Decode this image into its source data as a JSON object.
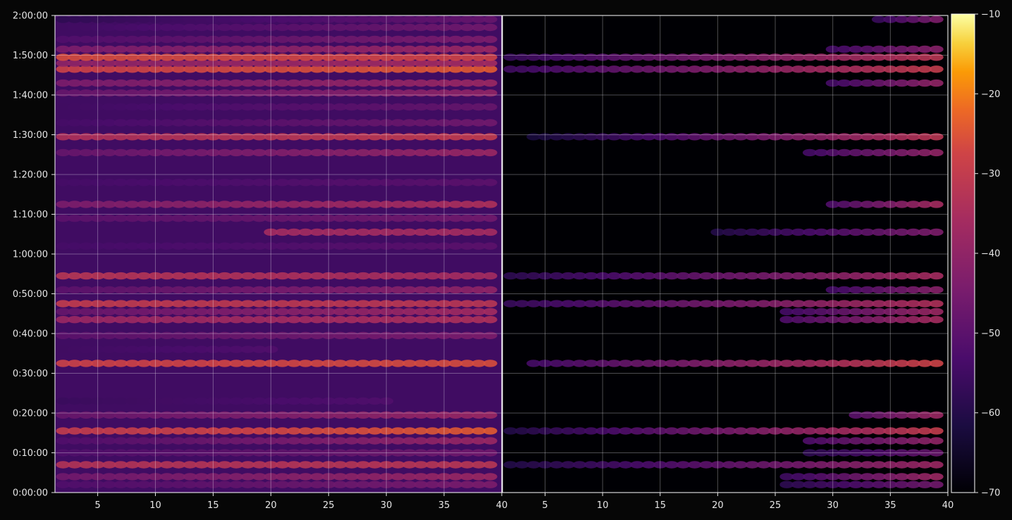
{
  "chart_data": {
    "type": "heatmap",
    "title": "",
    "colormap": "inferno",
    "background": "#060606",
    "grid": true,
    "panels": [
      {
        "name": "",
        "xlim": [
          1.3,
          40
        ],
        "xticks": [
          "5",
          "10",
          "15",
          "20",
          "25",
          "30",
          "35",
          "40"
        ],
        "xtick_values": [
          5,
          10,
          15,
          20,
          25,
          30,
          35,
          40
        ],
        "background_level": -55,
        "bands": [
          {
            "t": 2,
            "x0": 2,
            "x1": 39,
            "v0": -52,
            "v1": -44
          },
          {
            "t": 4,
            "x0": 2,
            "x1": 39,
            "v0": -46,
            "v1": -38
          },
          {
            "t": 7,
            "x0": 2,
            "x1": 39,
            "v0": -33,
            "v1": -32
          },
          {
            "t": 10,
            "x0": 2,
            "x1": 39,
            "v0": -52,
            "v1": -46
          },
          {
            "t": 13,
            "x0": 2,
            "x1": 39,
            "v0": -52,
            "v1": -38
          },
          {
            "t": 15.5,
            "x0": 2,
            "x1": 39,
            "v0": -30,
            "v1": -24
          },
          {
            "t": 19.5,
            "x0": 2,
            "x1": 39,
            "v0": -48,
            "v1": -38
          },
          {
            "t": 23,
            "x0": 2,
            "x1": 30,
            "v0": -56,
            "v1": -52
          },
          {
            "t": 32.5,
            "x0": 2,
            "x1": 39,
            "v0": -28,
            "v1": -26
          },
          {
            "t": 36,
            "x0": 2,
            "x1": 20,
            "v0": -55,
            "v1": -52
          },
          {
            "t": 39.5,
            "x0": 2,
            "x1": 39,
            "v0": -50,
            "v1": -44
          },
          {
            "t": 43.5,
            "x0": 2,
            "x1": 39,
            "v0": -38,
            "v1": -34
          },
          {
            "t": 45.5,
            "x0": 2,
            "x1": 39,
            "v0": -48,
            "v1": -36
          },
          {
            "t": 47.5,
            "x0": 2,
            "x1": 39,
            "v0": -30,
            "v1": -32
          },
          {
            "t": 51,
            "x0": 2,
            "x1": 39,
            "v0": -50,
            "v1": -40
          },
          {
            "t": 54.5,
            "x0": 2,
            "x1": 39,
            "v0": -32,
            "v1": -36
          },
          {
            "t": 62,
            "x0": 2,
            "x1": 39,
            "v0": -54,
            "v1": -50
          },
          {
            "t": 65.5,
            "x0": 20,
            "x1": 39,
            "v0": -36,
            "v1": -36
          },
          {
            "t": 69,
            "x0": 2,
            "x1": 39,
            "v0": -50,
            "v1": -46
          },
          {
            "t": 72.5,
            "x0": 2,
            "x1": 39,
            "v0": -44,
            "v1": -34
          },
          {
            "t": 78,
            "x0": 2,
            "x1": 39,
            "v0": -54,
            "v1": -50
          },
          {
            "t": 85.5,
            "x0": 2,
            "x1": 39,
            "v0": -48,
            "v1": -38
          },
          {
            "t": 89.5,
            "x0": 2,
            "x1": 39,
            "v0": -34,
            "v1": -30
          },
          {
            "t": 93,
            "x0": 2,
            "x1": 39,
            "v0": -54,
            "v1": -46
          },
          {
            "t": 97,
            "x0": 2,
            "x1": 39,
            "v0": -55,
            "v1": -48
          },
          {
            "t": 100.5,
            "x0": 2,
            "x1": 39,
            "v0": -48,
            "v1": -40
          },
          {
            "t": 103,
            "x0": 2,
            "x1": 39,
            "v0": -44,
            "v1": -38
          },
          {
            "t": 106.5,
            "x0": 2,
            "x1": 39,
            "v0": -28,
            "v1": -24
          },
          {
            "t": 108,
            "x0": 2,
            "x1": 39,
            "v0": -40,
            "v1": -36
          },
          {
            "t": 109.5,
            "x0": 2,
            "x1": 39,
            "v0": -26,
            "v1": -28
          },
          {
            "t": 111.5,
            "x0": 2,
            "x1": 39,
            "v0": -44,
            "v1": -38
          },
          {
            "t": 114,
            "x0": 2,
            "x1": 39,
            "v0": -52,
            "v1": -44
          },
          {
            "t": 117,
            "x0": 2,
            "x1": 39,
            "v0": -55,
            "v1": -46
          },
          {
            "t": 119,
            "x0": 2,
            "x1": 39,
            "v0": -58,
            "v1": -48
          }
        ]
      },
      {
        "name": "",
        "xlim": [
          1.3,
          40
        ],
        "xticks": [
          "5",
          "10",
          "15",
          "20",
          "25",
          "30",
          "35",
          "40"
        ],
        "xtick_values": [
          5,
          10,
          15,
          20,
          25,
          30,
          35,
          40
        ],
        "background_level": -70,
        "bands": [
          {
            "t": 2,
            "x0": 26,
            "x1": 39,
            "v0": -58,
            "v1": -46
          },
          {
            "t": 4,
            "x0": 26,
            "x1": 39,
            "v0": -55,
            "v1": -38
          },
          {
            "t": 7,
            "x0": 2,
            "x1": 39,
            "v0": -60,
            "v1": -38
          },
          {
            "t": 10,
            "x0": 28,
            "x1": 39,
            "v0": -58,
            "v1": -48
          },
          {
            "t": 13,
            "x0": 28,
            "x1": 39,
            "v0": -52,
            "v1": -40
          },
          {
            "t": 15.5,
            "x0": 2,
            "x1": 39,
            "v0": -60,
            "v1": -30
          },
          {
            "t": 19.5,
            "x0": 32,
            "x1": 39,
            "v0": -50,
            "v1": -38
          },
          {
            "t": 32.5,
            "x0": 4,
            "x1": 39,
            "v0": -54,
            "v1": -28
          },
          {
            "t": 43.5,
            "x0": 26,
            "x1": 39,
            "v0": -52,
            "v1": -36
          },
          {
            "t": 45.5,
            "x0": 26,
            "x1": 39,
            "v0": -54,
            "v1": -38
          },
          {
            "t": 47.5,
            "x0": 2,
            "x1": 39,
            "v0": -56,
            "v1": -34
          },
          {
            "t": 51,
            "x0": 30,
            "x1": 39,
            "v0": -54,
            "v1": -42
          },
          {
            "t": 54.5,
            "x0": 2,
            "x1": 39,
            "v0": -58,
            "v1": -36
          },
          {
            "t": 65.5,
            "x0": 20,
            "x1": 39,
            "v0": -60,
            "v1": -44
          },
          {
            "t": 72.5,
            "x0": 30,
            "x1": 39,
            "v0": -52,
            "v1": -36
          },
          {
            "t": 85.5,
            "x0": 28,
            "x1": 39,
            "v0": -54,
            "v1": -40
          },
          {
            "t": 89.5,
            "x0": 4,
            "x1": 39,
            "v0": -62,
            "v1": -32
          },
          {
            "t": 103,
            "x0": 30,
            "x1": 39,
            "v0": -54,
            "v1": -40
          },
          {
            "t": 106.5,
            "x0": 2,
            "x1": 39,
            "v0": -55,
            "v1": -30
          },
          {
            "t": 109.5,
            "x0": 2,
            "x1": 39,
            "v0": -56,
            "v1": -32
          },
          {
            "t": 111.5,
            "x0": 30,
            "x1": 39,
            "v0": -54,
            "v1": -42
          },
          {
            "t": 119,
            "x0": 34,
            "x1": 39,
            "v0": -56,
            "v1": -44
          }
        ]
      }
    ],
    "y_axis": {
      "label": "",
      "range_minutes": [
        0,
        120
      ],
      "ticks": [
        {
          "value": 0,
          "label": "0:00:00"
        },
        {
          "value": 10,
          "label": "0:10:00"
        },
        {
          "value": 20,
          "label": "0:20:00"
        },
        {
          "value": 30,
          "label": "0:30:00"
        },
        {
          "value": 40,
          "label": "0:40:00"
        },
        {
          "value": 50,
          "label": "0:50:00"
        },
        {
          "value": 60,
          "label": "1:00:00"
        },
        {
          "value": 70,
          "label": "1:10:00"
        },
        {
          "value": 80,
          "label": "1:20:00"
        },
        {
          "value": 90,
          "label": "1:30:00"
        },
        {
          "value": 100,
          "label": "1:40:00"
        },
        {
          "value": 110,
          "label": "1:50:00"
        },
        {
          "value": 120,
          "label": "2:00:00"
        }
      ]
    },
    "colorbar": {
      "range": [
        -70,
        -10
      ],
      "ticks": [
        {
          "value": -10,
          "label": "−10"
        },
        {
          "value": -20,
          "label": "−20"
        },
        {
          "value": -30,
          "label": "−30"
        },
        {
          "value": -40,
          "label": "−40"
        },
        {
          "value": -50,
          "label": "−50"
        },
        {
          "value": -60,
          "label": "−60"
        },
        {
          "value": -70,
          "label": "−70"
        }
      ]
    }
  }
}
